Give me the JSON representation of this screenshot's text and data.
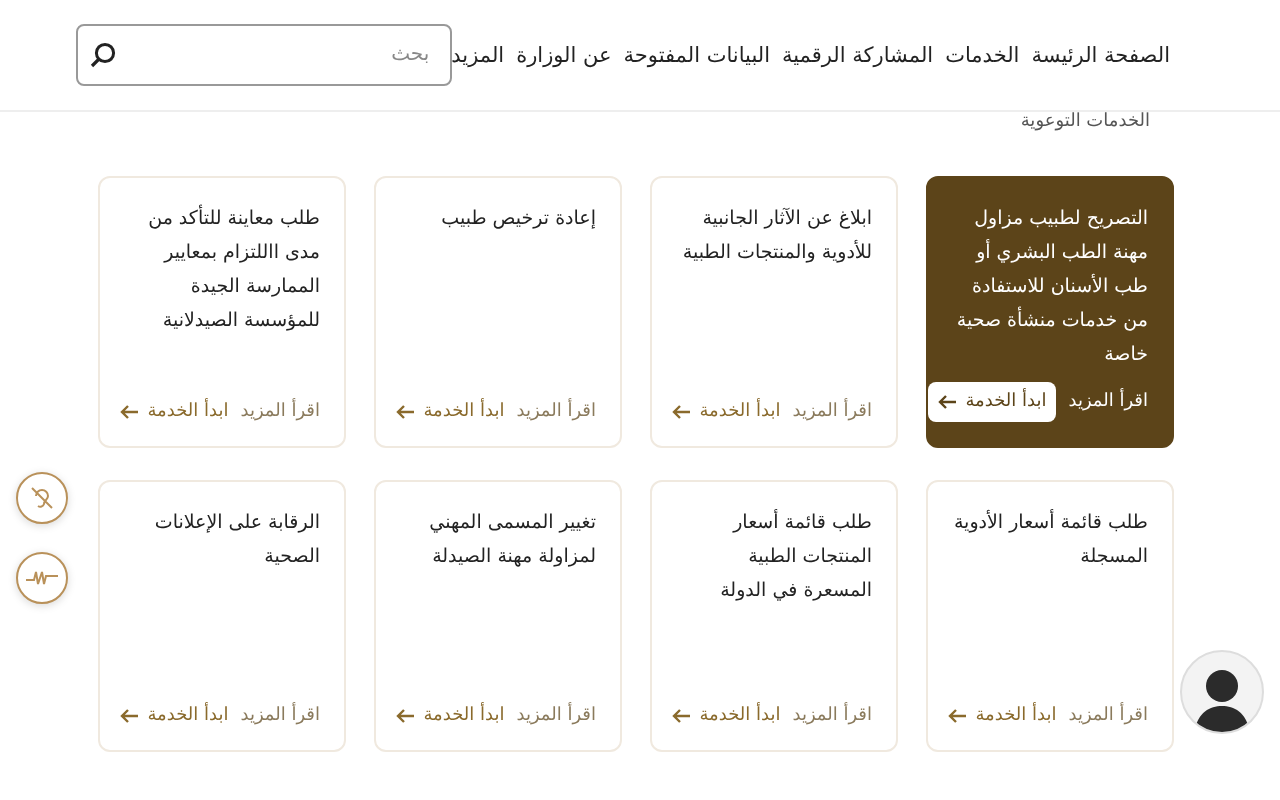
{
  "nav": {
    "items": [
      "الصفحة الرئيسة",
      "الخدمات",
      "المشاركة الرقمية",
      "البيانات المفتوحة",
      "عن الوزارة",
      "المزيد"
    ]
  },
  "search": {
    "placeholder": "بحث"
  },
  "section_heading": "الخدمات التوعوية",
  "cards": [
    {
      "title": "التصريح لطبيب مزاول مهنة الطب البشري أو طب الأسنان للاستفادة من خدمات منشأة صحية خاصة",
      "read_more": "اقرأ المزيد",
      "start": "ابدأ الخدمة",
      "selected": true
    },
    {
      "title": "ابلاغ عن الآثار الجانبية للأدوية والمنتجات الطبية",
      "read_more": "اقرأ المزيد",
      "start": "ابدأ الخدمة",
      "selected": false
    },
    {
      "title": "إعادة ترخيص طبيب",
      "read_more": "اقرأ المزيد",
      "start": "ابدأ الخدمة",
      "selected": false
    },
    {
      "title": "طلب معاينة للتأكد من مدى االلتزام بمعايير الممارسة الجيدة للمؤسسة الصيدلانية",
      "read_more": "اقرأ المزيد",
      "start": "ابدأ الخدمة",
      "selected": false
    },
    {
      "title": "طلب قائمة أسعار الأدوية المسجلة",
      "read_more": "اقرأ المزيد",
      "start": "ابدأ الخدمة",
      "selected": false
    },
    {
      "title": "طلب قائمة أسعار المنتجات الطبية المسعرة في الدولة",
      "read_more": "اقرأ المزيد",
      "start": "ابدأ الخدمة",
      "selected": false
    },
    {
      "title": "تغيير المسمى المهني لمزاولة مهنة الصيدلة",
      "read_more": "اقرأ المزيد",
      "start": "ابدأ الخدمة",
      "selected": false
    },
    {
      "title": "الرقابة على الإعلانات الصحية",
      "read_more": "اقرأ المزيد",
      "start": "ابدأ الخدمة",
      "selected": false
    }
  ]
}
